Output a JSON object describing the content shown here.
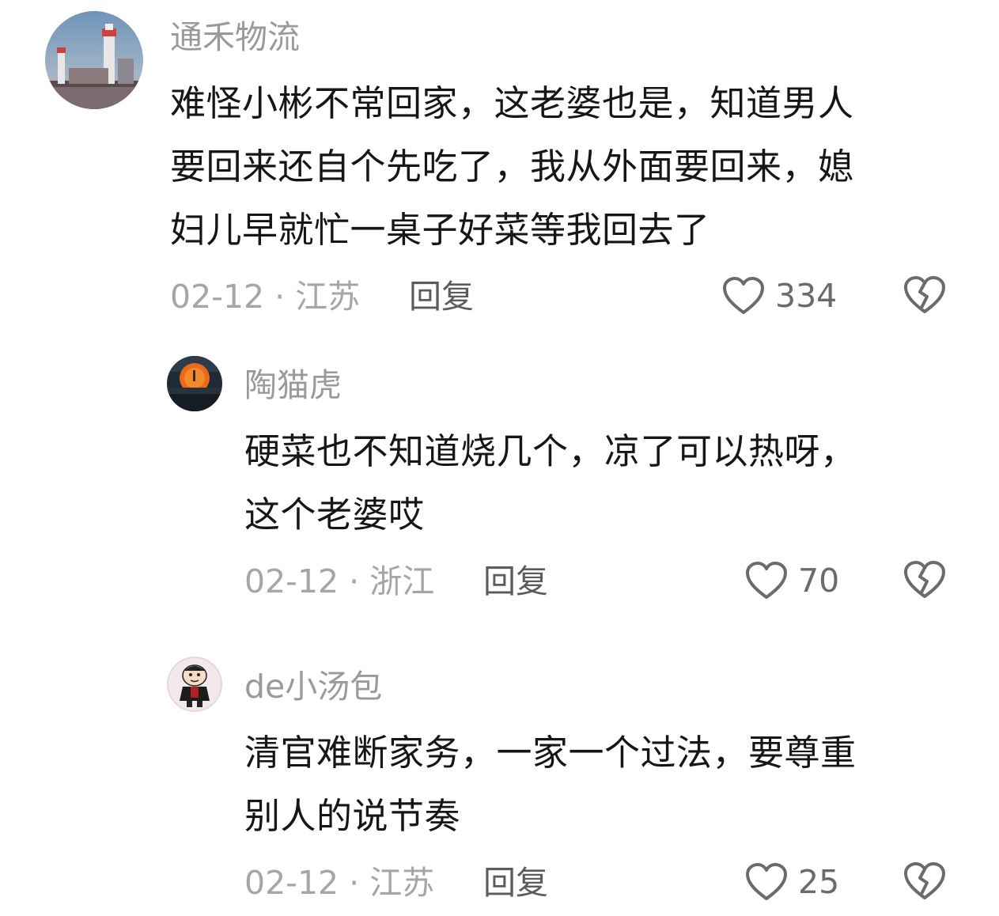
{
  "comments": [
    {
      "username": "通禾物流",
      "lines": [
        "难怪小彬不常回家，这老婆也是，知道男人",
        "要回来还自个先吃了，我从外面要回来，媳",
        "妇儿早就忙一桌子好菜等我回去了"
      ],
      "meta": "02-12 · 江苏",
      "reply_label": "回复",
      "likes": "334"
    },
    {
      "username": "陶猫虎",
      "lines": [
        "硬菜也不知道烧几个，凉了可以热呀，",
        "这个老婆哎"
      ],
      "meta": "02-12 · 浙江",
      "reply_label": "回复",
      "likes": "70"
    },
    {
      "username": "de小汤包",
      "lines": [
        "清官难断家务，一家一个过法，要尊重",
        "别人的说节奏"
      ],
      "meta": "02-12 · 江苏",
      "reply_label": "回复",
      "likes": "25"
    }
  ],
  "icons": {
    "like": "heart-outline-icon",
    "dislike": "broken-heart-icon"
  }
}
